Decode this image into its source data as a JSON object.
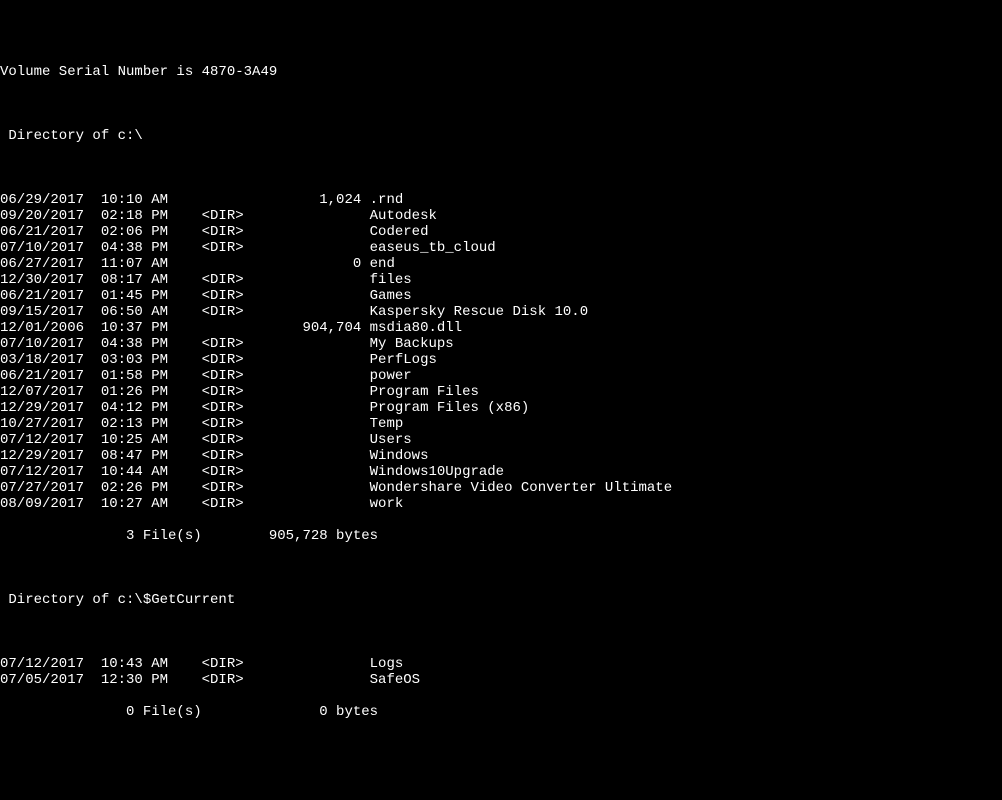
{
  "header": {
    "volume": "Volume Serial Number is 4870-3A49",
    "dir1": " Directory of c:\\",
    "dir2": " Directory of c:\\$GetCurrent"
  },
  "listing1": [
    {
      "date": "06/29/2017",
      "time": "10:10 AM",
      "type": "",
      "size": "1,024",
      "name": ".rnd"
    },
    {
      "date": "09/20/2017",
      "time": "02:18 PM",
      "type": "<DIR>",
      "size": "",
      "name": "Autodesk"
    },
    {
      "date": "06/21/2017",
      "time": "02:06 PM",
      "type": "<DIR>",
      "size": "",
      "name": "Codered"
    },
    {
      "date": "07/10/2017",
      "time": "04:38 PM",
      "type": "<DIR>",
      "size": "",
      "name": "easeus_tb_cloud"
    },
    {
      "date": "06/27/2017",
      "time": "11:07 AM",
      "type": "",
      "size": "0",
      "name": "end"
    },
    {
      "date": "12/30/2017",
      "time": "08:17 AM",
      "type": "<DIR>",
      "size": "",
      "name": "files"
    },
    {
      "date": "06/21/2017",
      "time": "01:45 PM",
      "type": "<DIR>",
      "size": "",
      "name": "Games"
    },
    {
      "date": "09/15/2017",
      "time": "06:50 AM",
      "type": "<DIR>",
      "size": "",
      "name": "Kaspersky Rescue Disk 10.0"
    },
    {
      "date": "12/01/2006",
      "time": "10:37 PM",
      "type": "",
      "size": "904,704",
      "name": "msdia80.dll"
    },
    {
      "date": "07/10/2017",
      "time": "04:38 PM",
      "type": "<DIR>",
      "size": "",
      "name": "My Backups"
    },
    {
      "date": "03/18/2017",
      "time": "03:03 PM",
      "type": "<DIR>",
      "size": "",
      "name": "PerfLogs"
    },
    {
      "date": "06/21/2017",
      "time": "01:58 PM",
      "type": "<DIR>",
      "size": "",
      "name": "power"
    },
    {
      "date": "12/07/2017",
      "time": "01:26 PM",
      "type": "<DIR>",
      "size": "",
      "name": "Program Files"
    },
    {
      "date": "12/29/2017",
      "time": "04:12 PM",
      "type": "<DIR>",
      "size": "",
      "name": "Program Files (x86)"
    },
    {
      "date": "10/27/2017",
      "time": "02:13 PM",
      "type": "<DIR>",
      "size": "",
      "name": "Temp"
    },
    {
      "date": "07/12/2017",
      "time": "10:25 AM",
      "type": "<DIR>",
      "size": "",
      "name": "Users"
    },
    {
      "date": "12/29/2017",
      "time": "08:47 PM",
      "type": "<DIR>",
      "size": "",
      "name": "Windows"
    },
    {
      "date": "07/12/2017",
      "time": "10:44 AM",
      "type": "<DIR>",
      "size": "",
      "name": "Windows10Upgrade"
    },
    {
      "date": "07/27/2017",
      "time": "02:26 PM",
      "type": "<DIR>",
      "size": "",
      "name": "Wondershare Video Converter Ultimate"
    },
    {
      "date": "08/09/2017",
      "time": "10:27 AM",
      "type": "<DIR>",
      "size": "",
      "name": "work"
    }
  ],
  "summary1": {
    "files_count": "3",
    "files_label": "File(s)",
    "bytes": "905,728",
    "bytes_label": "bytes"
  },
  "listing2": [
    {
      "date": "07/12/2017",
      "time": "10:43 AM",
      "type": "<DIR>",
      "size": "",
      "name": "Logs"
    },
    {
      "date": "07/05/2017",
      "time": "12:30 PM",
      "type": "<DIR>",
      "size": "",
      "name": "SafeOS"
    }
  ],
  "summary2": {
    "files_count": "0",
    "files_label": "File(s)",
    "bytes": "0",
    "bytes_label": "bytes"
  }
}
